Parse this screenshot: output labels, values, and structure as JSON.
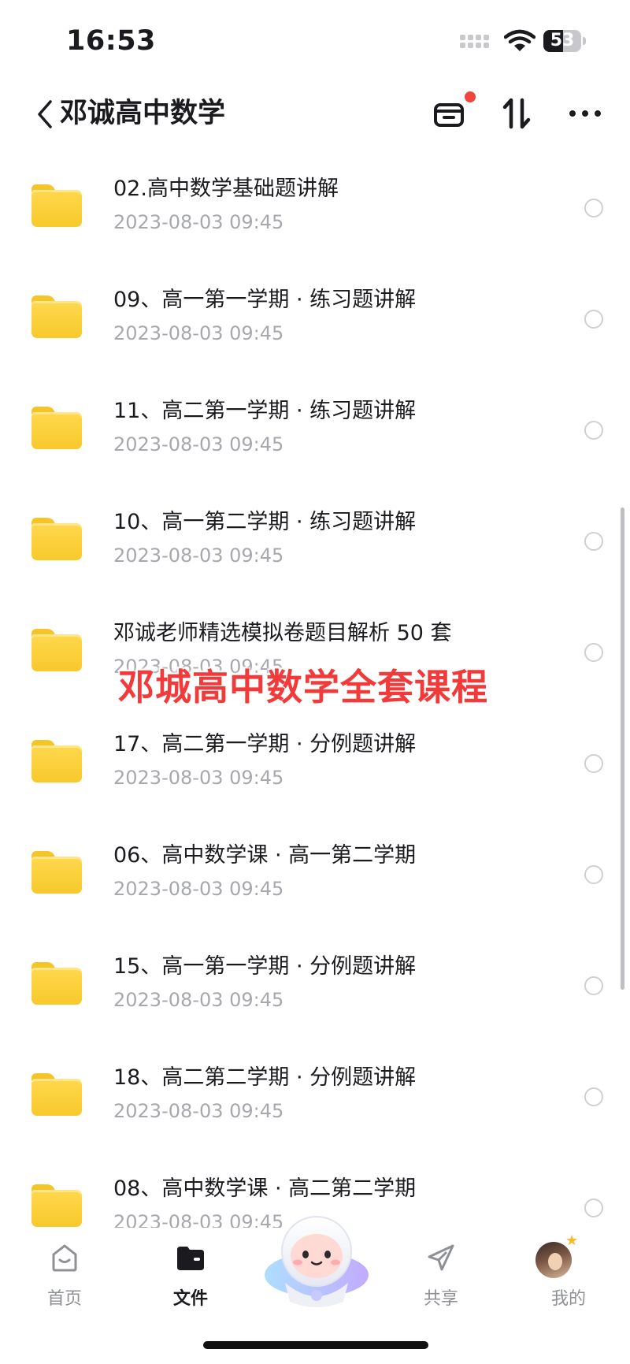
{
  "status_bar": {
    "time": "16:53",
    "battery": "53",
    "battery_level": 0.53
  },
  "header": {
    "title": "邓诚高中数学"
  },
  "files": [
    {
      "name": "02.高中数学基础题讲解",
      "date": "2023-08-03 09:45"
    },
    {
      "name": "09、高一第一学期 · 练习题讲解",
      "date": "2023-08-03 09:45"
    },
    {
      "name": "11、高二第一学期 · 练习题讲解",
      "date": "2023-08-03 09:45"
    },
    {
      "name": "10、高一第二学期 · 练习题讲解",
      "date": "2023-08-03 09:45"
    },
    {
      "name": "邓诚老师精选模拟卷题目解析 50 套",
      "date": "2023-08-03 09:45"
    },
    {
      "name": "17、高二第一学期 · 分例题讲解",
      "date": "2023-08-03 09:45"
    },
    {
      "name": "06、高中数学课 · 高一第二学期",
      "date": "2023-08-03 09:45"
    },
    {
      "name": "15、高一第一学期 · 分例题讲解",
      "date": "2023-08-03 09:45"
    },
    {
      "name": "18、高二第二学期 · 分例题讲解",
      "date": "2023-08-03 09:45"
    },
    {
      "name": "08、高中数学课 · 高二第二学期",
      "date": "2023-08-03 09:45"
    }
  ],
  "watermark": "邓城高中数学全套课程",
  "nav": {
    "home": "首页",
    "files": "文件",
    "share": "共享",
    "mine": "我的"
  },
  "colors": {
    "folder": "#f7c92c",
    "badge": "#f0463c",
    "watermark": "#f23a3a"
  }
}
